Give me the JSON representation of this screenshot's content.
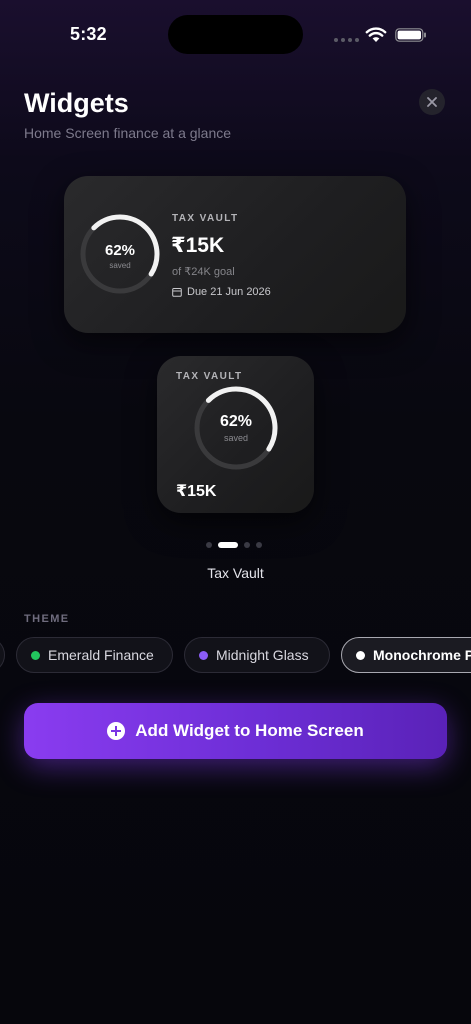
{
  "status_bar": {
    "time": "5:32"
  },
  "header": {
    "title": "Widgets",
    "subtitle": "Home Screen finance at a glance"
  },
  "widgets": {
    "medium": {
      "label": "TAX VAULT",
      "amount": "₹15K",
      "goal": "of ₹24K goal",
      "due": "Due 21 Jun 2026",
      "percent_text": "62%",
      "percent_caption": "saved",
      "progress": 0.62
    },
    "small": {
      "label": "TAX VAULT",
      "amount": "₹15K",
      "percent_text": "62%",
      "percent_caption": "saved",
      "progress": 0.62
    }
  },
  "pager": {
    "current_index": 1,
    "total": 4,
    "current_name": "Tax Vault"
  },
  "theme": {
    "label": "THEME",
    "options": [
      {
        "name": "Emerald Finance",
        "color": "#22c55e"
      },
      {
        "name": "Midnight Glass",
        "color": "#8b5cf6"
      },
      {
        "name": "Monochrome P",
        "color": "#ffffff",
        "selected": true
      }
    ]
  },
  "actions": {
    "add_widget": "Add Widget to Home Screen"
  },
  "colors": {
    "accent": "#7c3aed",
    "ring_progress": "#f2f2f2",
    "ring_track": "#3a3a3c"
  }
}
